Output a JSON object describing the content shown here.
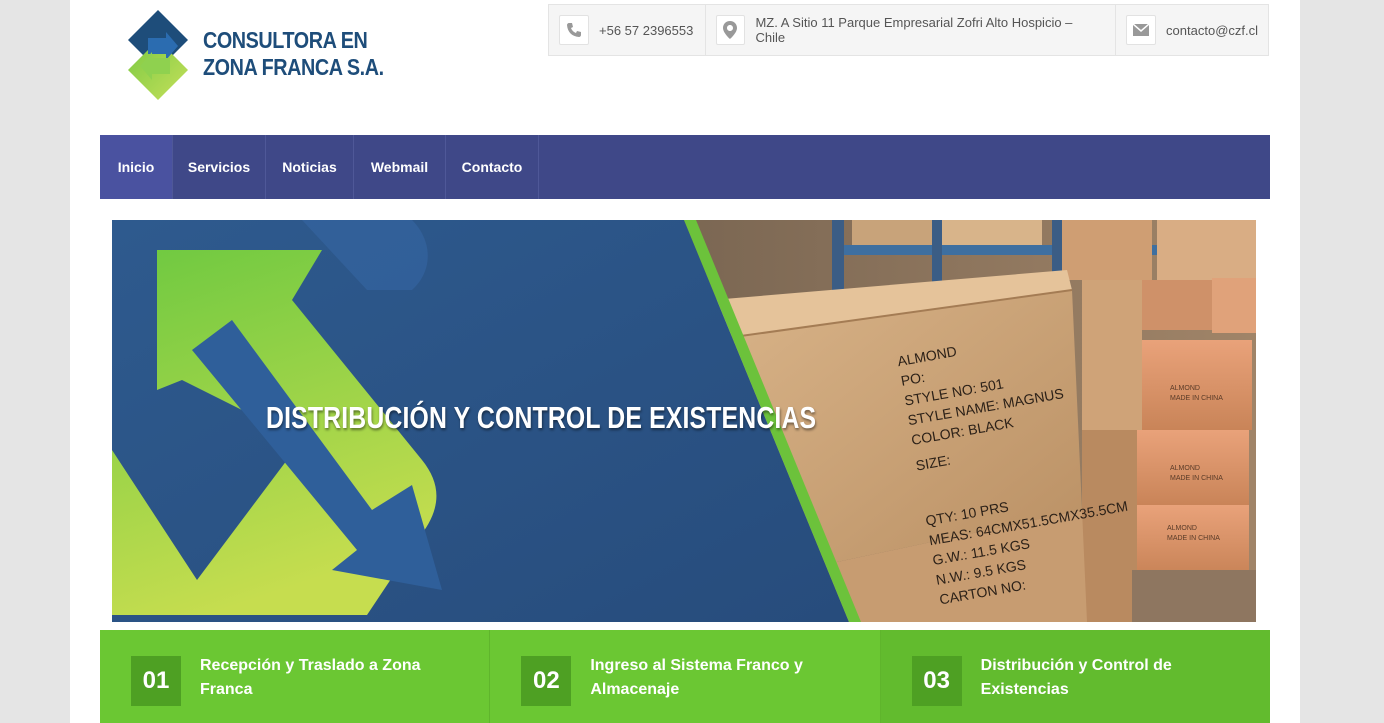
{
  "brand": {
    "line1": "CONSULTORA EN",
    "line2": "ZONA FRANCA S.A.",
    "colors": {
      "navy": "#1e4d7a",
      "blue": "#2b6cb0",
      "green": "#7ac943",
      "lime": "#c6e05a"
    }
  },
  "contact": {
    "phone": "+56 57 2396553",
    "address": "MZ. A Sitio 11 Parque Empresarial Zofri Alto Hospicio – Chile",
    "email": "contacto@czf.cl",
    "icons": [
      "phone-icon",
      "map-pin-icon",
      "envelope-icon"
    ]
  },
  "nav": {
    "items": [
      {
        "label": "Inicio",
        "active": true
      },
      {
        "label": "Servicios"
      },
      {
        "label": "Noticias"
      },
      {
        "label": "Webmail"
      },
      {
        "label": "Contacto"
      }
    ],
    "color": "#3f4888"
  },
  "banner": {
    "caption": "DISTRIBUCIÓN Y CONTROL DE EXISTENCIAS",
    "box_text": {
      "brand": "ALMOND",
      "po": "PO:",
      "style_no": "STYLE NO: 501",
      "style_name": "STYLE NAME: MAGNUS",
      "color": "COLOR: BLACK",
      "size": "SIZE:",
      "qty": "QTY: 10 PRS",
      "meas": "MEAS: 64CMX51.5CMX35.5CM",
      "gw": "G.W.: 11.5 KGS",
      "nw": "N.W.: 9.5 KGS",
      "carton": "CARTON NO:",
      "small_a": "ALMOND",
      "small_b": "MADE IN CHINA"
    }
  },
  "steps": [
    {
      "num": "01",
      "title": "Recepción y Traslado a Zona Franca"
    },
    {
      "num": "02",
      "title": "Ingreso al Sistema Franco y Almacenaje"
    },
    {
      "num": "03",
      "title": "Distribución y Control de Existencias"
    }
  ]
}
